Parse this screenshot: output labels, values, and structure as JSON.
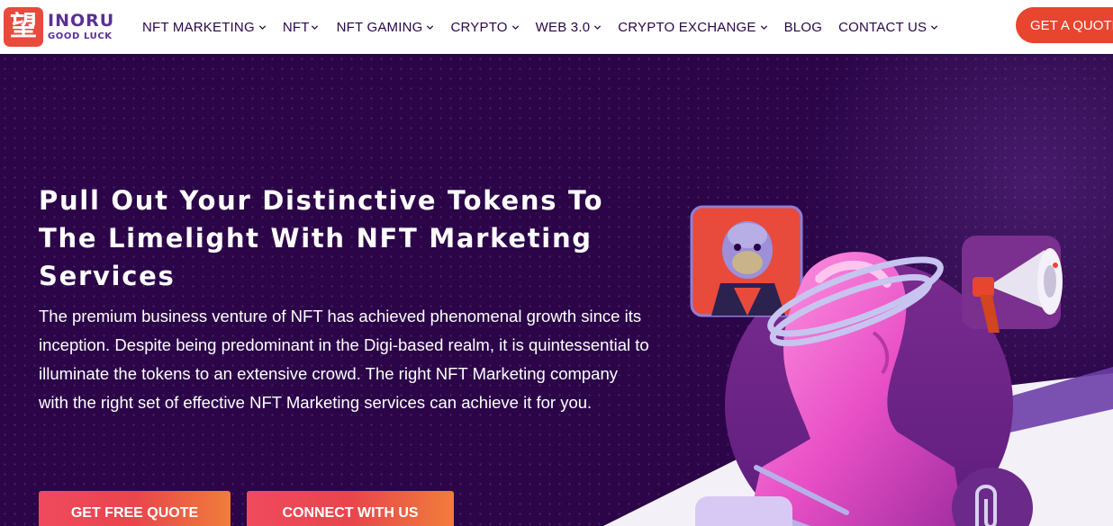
{
  "brand": {
    "mark": "望",
    "name": "INORU",
    "tagline": "GOOD LUCK",
    "accent": "#e84a3c",
    "name_color": "#5b2f93"
  },
  "nav": {
    "items": [
      {
        "label": "NFT MARKETING",
        "has_dropdown": true
      },
      {
        "label": "NFT",
        "has_dropdown": true
      },
      {
        "label": "NFT GAMING",
        "has_dropdown": true
      },
      {
        "label": "CRYPTO",
        "has_dropdown": true
      },
      {
        "label": "WEB 3.0",
        "has_dropdown": true
      },
      {
        "label": "CRYPTO EXCHANGE",
        "has_dropdown": true
      },
      {
        "label": "BLOG",
        "has_dropdown": false
      },
      {
        "label": "CONTACT US",
        "has_dropdown": true
      }
    ],
    "cta_label": "GET A QUOTE"
  },
  "hero": {
    "headline": "Pull Out Your Distinctive Tokens To The Limelight With NFT Marketing Services",
    "description": "The premium business venture of NFT has achieved phenomenal growth since its inception. Despite being predominant in the Digi-based realm, it is quintessential to illuminate the tokens to an extensive crowd. The right NFT Marketing company with the right set of effective NFT Marketing services can achieve it for you.",
    "primary_button": "GET FREE QUOTE",
    "secondary_button": "CONNECT WITH US",
    "background": "#2b0548",
    "button_gradient": [
      "#f04a5e",
      "#f07d3a"
    ]
  },
  "icons": {
    "dropdown": "chevron-down-icon",
    "illustration": "nft-bust-illustration",
    "ape": "ape-nft-icon",
    "megaphone": "megaphone-icon",
    "paperclip": "paperclip-icon"
  }
}
